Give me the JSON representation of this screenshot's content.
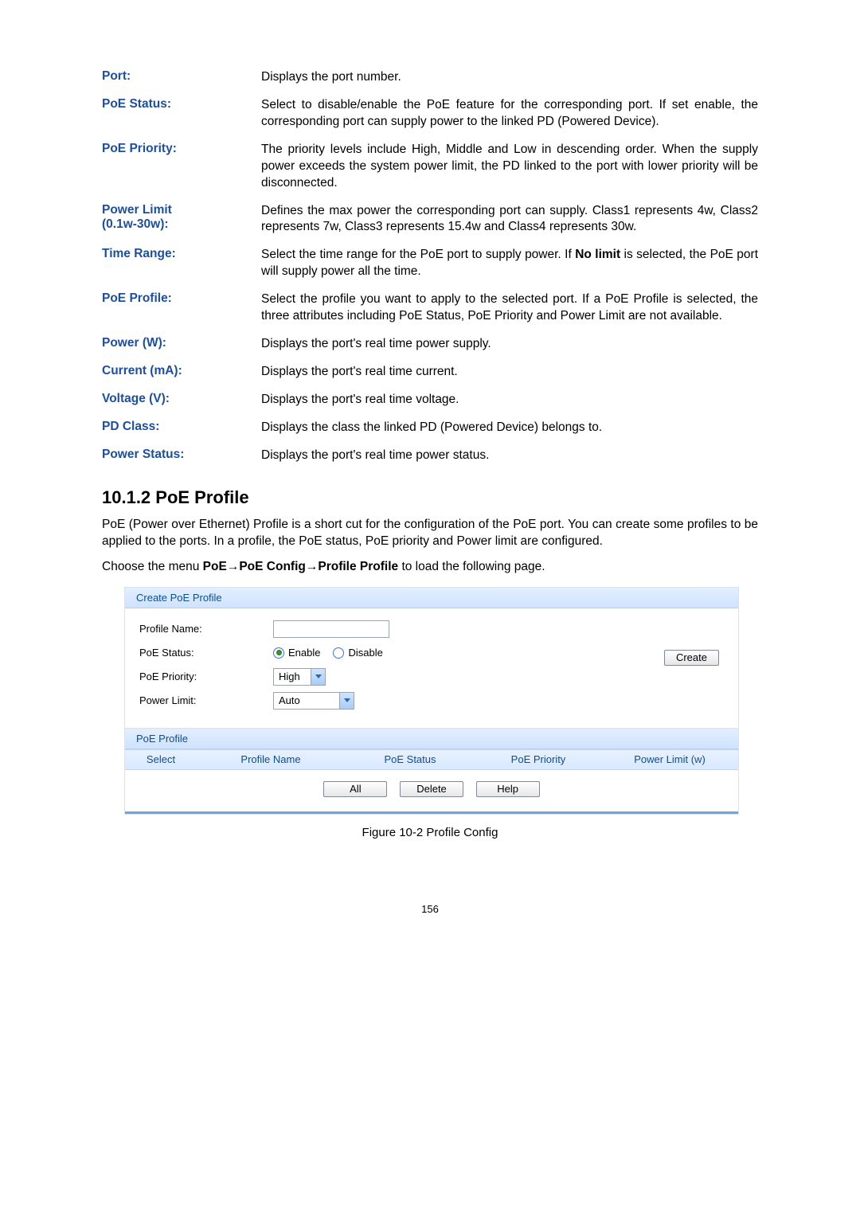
{
  "definitions": [
    {
      "term": "Port:",
      "desc": "Displays the port number."
    },
    {
      "term": "PoE Status:",
      "desc": "Select to disable/enable the PoE feature for the corresponding port. If set enable, the corresponding port can supply power to the linked PD (Powered Device)."
    },
    {
      "term": "PoE Priority:",
      "desc": "The priority levels include High, Middle and Low in descending order. When the supply power exceeds the system power limit, the PD linked to the port with lower priority will be disconnected."
    },
    {
      "term": "Power Limit (0.1w-30w):",
      "desc": "Defines the max power the corresponding port can supply. Class1 represents 4w, Class2 represents 7w, Class3 represents 15.4w and Class4 represents 30w."
    },
    {
      "term": "Time Range:",
      "desc_pre": "Select the time range for the PoE port to supply power. If ",
      "desc_bold": "No limit",
      "desc_post": " is selected, the PoE port will supply power all the time."
    },
    {
      "term": "PoE Profile:",
      "desc": "Select the profile you want to apply to the selected port. If a PoE Profile is selected, the three attributes including PoE Status, PoE Priority and Power Limit are not available."
    },
    {
      "term": "Power (W):",
      "desc": "Displays the port's real time power supply."
    },
    {
      "term": "Current (mA):",
      "desc": "Displays the port's real time current."
    },
    {
      "term": "Voltage (V):",
      "desc": "Displays the port's real time voltage."
    },
    {
      "term": "PD Class:",
      "desc": "Displays the class the linked PD (Powered Device) belongs to."
    },
    {
      "term": "Power Status:",
      "desc": "Displays the port's real time power status."
    }
  ],
  "section_heading": "10.1.2  PoE Profile",
  "section_para": "PoE (Power over Ethernet) Profile is a short cut for the configuration of the PoE port. You can create some profiles to be applied to the ports. In a profile, the PoE status, PoE priority and Power limit are configured.",
  "menu_path": {
    "prefix": "Choose the menu ",
    "b1": "PoE",
    "arrow1": "→",
    "b2": "PoE Config",
    "arrow2": "→",
    "b3": "Profile Profile",
    "suffix": " to load the following page."
  },
  "panel": {
    "create_header": "Create PoE Profile",
    "labels": {
      "profile_name": "Profile Name:",
      "poe_status": "PoE Status:",
      "poe_priority": "PoE Priority:",
      "power_limit": "Power Limit:"
    },
    "radio_enable": "Enable",
    "radio_disable": "Disable",
    "priority_value": "High",
    "limit_value": "Auto",
    "create_btn": "Create",
    "list_header": "PoE Profile",
    "cols": {
      "select": "Select",
      "name": "Profile Name",
      "status": "PoE Status",
      "priority": "PoE Priority",
      "limit": "Power Limit (w)"
    },
    "buttons": {
      "all": "All",
      "delete": "Delete",
      "help": "Help"
    }
  },
  "figure_caption": "Figure 10-2 Profile Config",
  "page_number": "156"
}
